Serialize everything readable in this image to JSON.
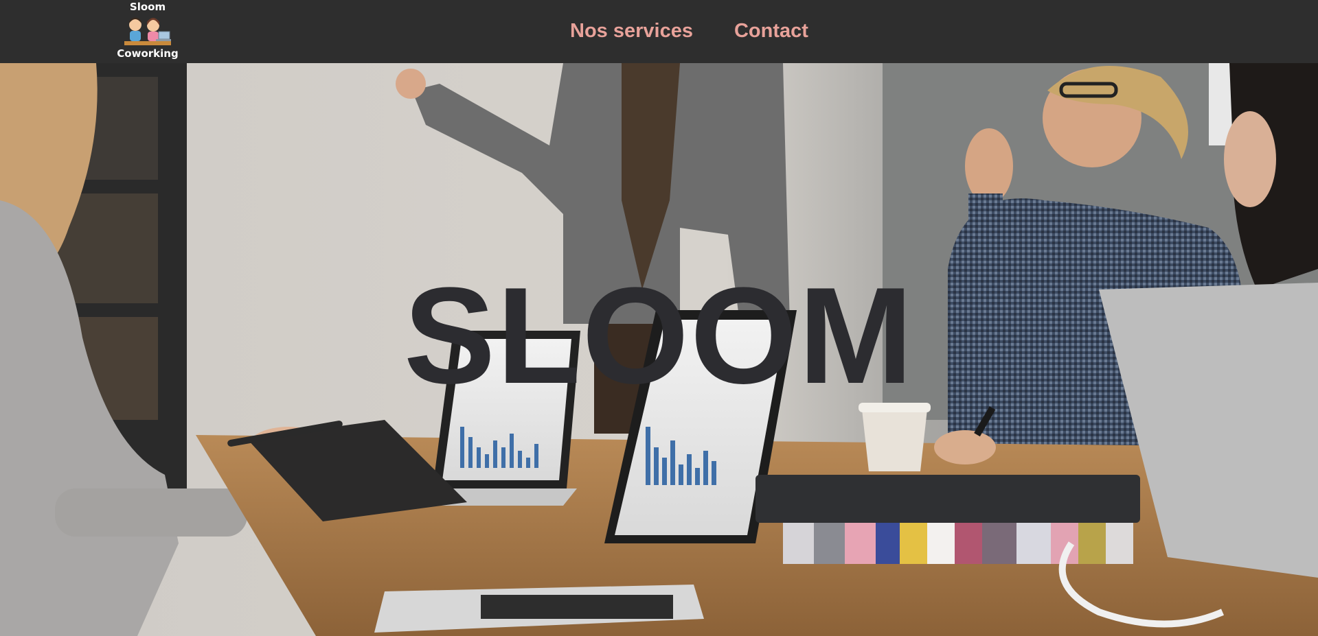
{
  "header": {
    "logo": {
      "top_text": "Sloom",
      "bottom_text": "Coworking",
      "icon": "two-people-at-laptop-icon"
    },
    "nav": [
      {
        "label": "Nos services"
      },
      {
        "label": "Contact"
      }
    ]
  },
  "hero": {
    "title": "SLOOM",
    "image": "team-meeting-photo",
    "title_color": "#2c2c30"
  },
  "colors": {
    "navbar_bg": "#2e2e2e",
    "nav_link": "#e8a29a"
  }
}
